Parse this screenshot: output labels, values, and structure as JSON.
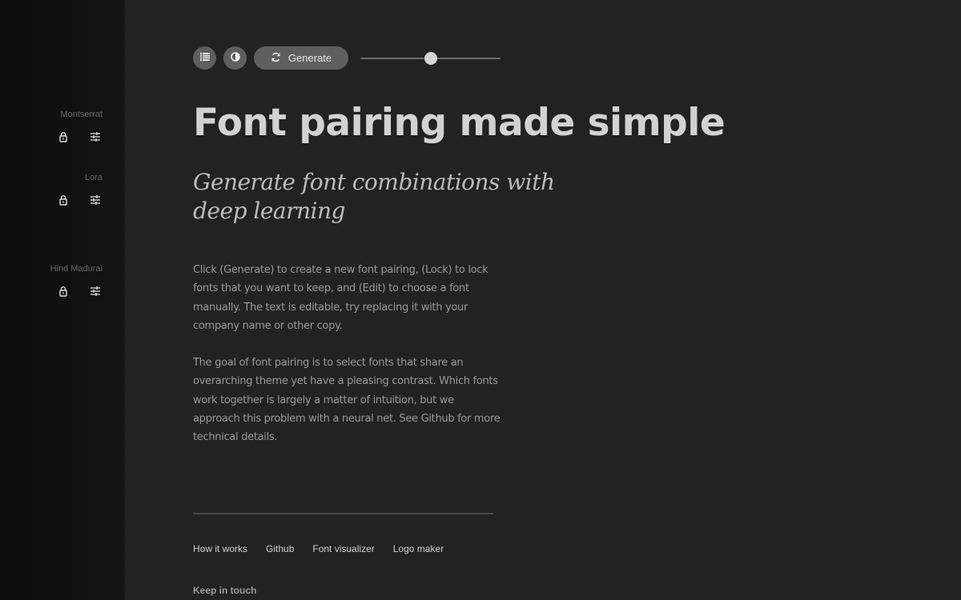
{
  "sidebar": {
    "fonts": [
      {
        "name": "Montserrat",
        "lock_icon": "lock-icon",
        "edit_icon": "sliders-icon"
      },
      {
        "name": "Lora",
        "lock_icon": "lock-icon",
        "edit_icon": "sliders-icon"
      },
      {
        "name": "Hind Madurai",
        "lock_icon": "lock-icon",
        "edit_icon": "sliders-icon"
      }
    ]
  },
  "toolbar": {
    "list_icon": "list-icon",
    "contrast_icon": "contrast-icon",
    "generate_label": "Generate",
    "generate_icon": "refresh-icon",
    "slider_value_percent": 50
  },
  "main": {
    "title": "Font pairing made simple",
    "subtitle": "Generate font combinations with deep learning",
    "paragraphs": [
      "Click (Generate) to create a new font pairing, (Lock) to lock fonts that you want to keep, and (Edit) to choose a font manually. The text is editable, try replacing it with your company name or other copy.",
      "The goal of font pairing is to select fonts that share an overarching theme yet have a pleasing contrast. Which fonts work together is largely a matter of intuition, but we approach this problem with a neural net. See Github for more technical details."
    ]
  },
  "footer": {
    "links": [
      "How it works",
      "Github",
      "Font visualizer",
      "Logo maker"
    ],
    "keep_in_touch": "Keep in touch"
  },
  "colors": {
    "background": "#222222",
    "sidebar": "#111111",
    "button": "#5f5f5f",
    "title": "#d2d2d2"
  }
}
